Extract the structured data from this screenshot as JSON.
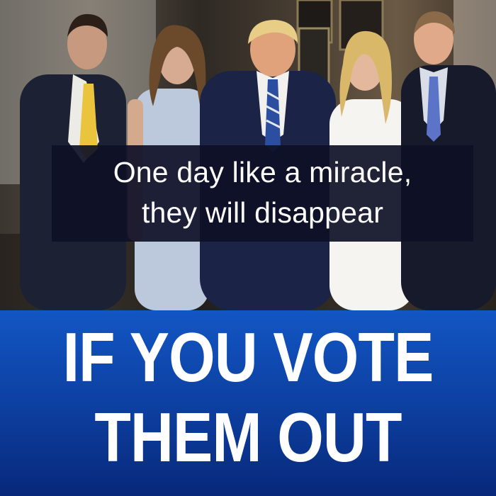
{
  "caption": {
    "line1": "One day like a miracle,",
    "line2": "they will disappear"
  },
  "headline": {
    "line1": "IF YOU VOTE",
    "line2": "THEM OUT"
  },
  "colors": {
    "banner_top": "#1256c4",
    "banner_bottom": "#08287a",
    "caption_bg": "#0e1026",
    "text": "#ffffff"
  }
}
